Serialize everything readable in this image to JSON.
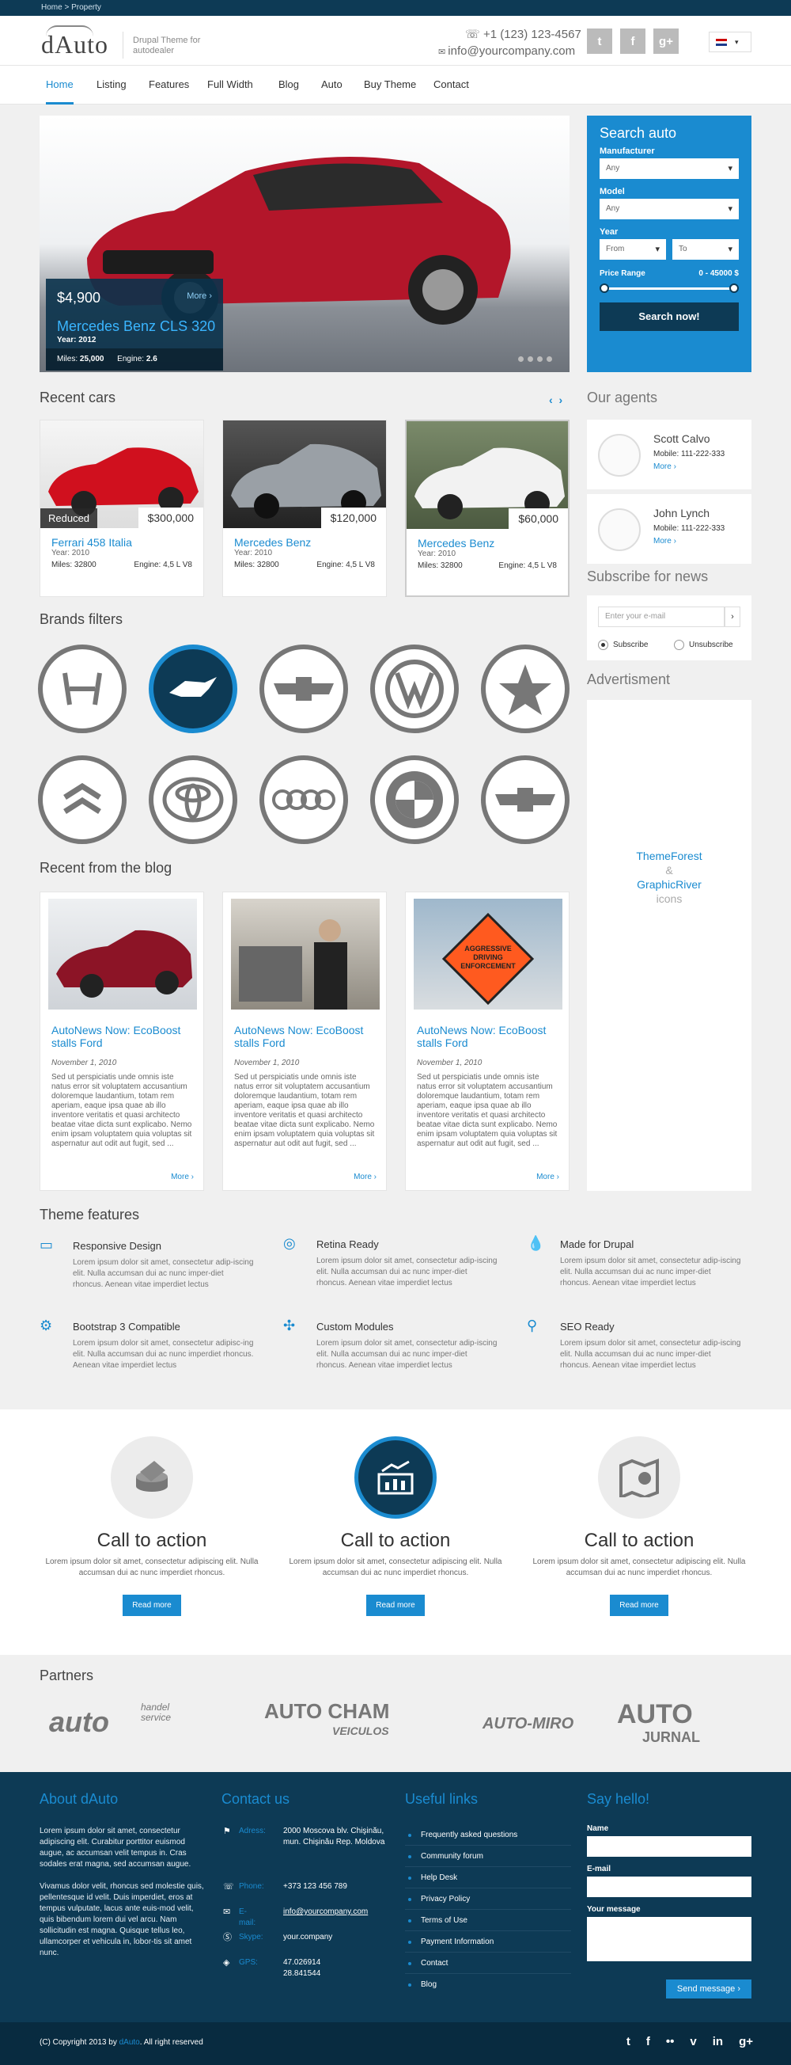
{
  "topbar": {
    "breadcrumb": "Home > Property"
  },
  "header": {
    "logo": "dAuto",
    "tagline": "Drupal Theme for autodealer",
    "phone": "+1 (123) 123-4567",
    "email": "info@yourcompany.com",
    "lang": "▾"
  },
  "nav": {
    "items": [
      "Home",
      "Listing",
      "Features",
      "Full Width",
      "Blog",
      "Auto",
      "Buy Theme",
      "Contact"
    ]
  },
  "hero": {
    "price": "$4,900",
    "more": "More",
    "title": "Mercedes Benz CLS 320",
    "year_label": "Year:",
    "year": "2012",
    "miles_label": "Miles:",
    "miles": "25,000",
    "engine_label": "Engine:",
    "engine": "2.6"
  },
  "search": {
    "title": "Search auto",
    "manufacturer_label": "Manufacturer",
    "manufacturer_value": "Any",
    "model_label": "Model",
    "model_value": "Any",
    "year_label": "Year",
    "year_from": "From",
    "year_to": "To",
    "price_label": "Price Range",
    "price_range": "0 - 45000 $",
    "button": "Search now!"
  },
  "recent": {
    "title": "Recent cars",
    "cars": [
      {
        "badge": "Reduced",
        "price": "$300,000",
        "title": "Ferrari 458 Italia",
        "year": "Year: 2010",
        "miles": "Miles: 32800",
        "engine": "Engine: 4,5 L V8"
      },
      {
        "badge": "",
        "price": "$120,000",
        "title": "Mercedes Benz",
        "year": "Year: 2010",
        "miles": "Miles: 32800",
        "engine": "Engine: 4,5 L V8"
      },
      {
        "badge": "",
        "price": "$60,000",
        "title": "Mercedes Benz",
        "year": "Year: 2010",
        "miles": "Miles: 32800",
        "engine": "Engine: 4,5 L V8"
      }
    ]
  },
  "brands": {
    "title": "Brands filters"
  },
  "agents": {
    "title": "Our agents",
    "list": [
      {
        "name": "Scott Calvo",
        "mobile": "Mobile:  111-222-333",
        "more": "More"
      },
      {
        "name": "John Lynch",
        "mobile": "Mobile:  111-222-333",
        "more": "More"
      }
    ]
  },
  "subscribe": {
    "title": "Subscribe for news",
    "placeholder": "Enter your e-mail",
    "subscribe": "Subscribe",
    "unsubscribe": "Unsubscribe"
  },
  "advert": {
    "title": "Advertisment",
    "line1": "ThemeForest",
    "line2": "&",
    "line3": "GraphicRiver",
    "line4": "icons"
  },
  "blog": {
    "title": "Recent from the blog",
    "posts": [
      {
        "title": "AutoNews Now: EcoBoost stalls Ford",
        "date": "November 1, 2010",
        "text": "Sed ut perspiciatis unde omnis iste natus error sit voluptatem accusantium doloremque laudantium, totam rem aperiam, eaque ipsa quae ab illo inventore veritatis et quasi architecto beatae vitae dicta sunt explicabo. Nemo enim ipsam voluptatem quia voluptas sit aspernatur aut odit aut fugit, sed ...",
        "more": "More"
      },
      {
        "title": "AutoNews Now: EcoBoost stalls Ford",
        "date": "November 1, 2010",
        "text": "Sed ut perspiciatis unde omnis iste natus error sit voluptatem accusantium doloremque laudantium, totam rem aperiam, eaque ipsa quae ab illo inventore veritatis et quasi architecto beatae vitae dicta sunt explicabo. Nemo enim ipsam voluptatem quia voluptas sit aspernatur aut odit aut fugit, sed ...",
        "more": "More"
      },
      {
        "title": "AutoNews Now: EcoBoost stalls Ford",
        "date": "November 1, 2010",
        "text": "Sed ut perspiciatis unde omnis iste natus error sit voluptatem accusantium doloremque laudantium, totam rem aperiam, eaque ipsa quae ab illo inventore veritatis et quasi architecto beatae vitae dicta sunt explicabo. Nemo enim ipsam voluptatem quia voluptas sit aspernatur aut odit aut fugit, sed ...",
        "more": "More"
      }
    ],
    "sign_text": "AGGRESSIVE DRIVING ENFORCEMENT"
  },
  "features": {
    "title": "Theme features",
    "items": [
      {
        "title": "Responsive Design",
        "text": "Lorem ipsum dolor sit amet, consectetur adip-iscing elit. Nulla accumsan dui ac nunc imper-diet rhoncus. Aenean vitae imperdiet lectus"
      },
      {
        "title": "Retina Ready",
        "text": "Lorem ipsum dolor sit amet, consectetur adip-iscing elit. Nulla accumsan dui ac nunc imper-diet rhoncus. Aenean vitae imperdiet lectus"
      },
      {
        "title": "Made for Drupal",
        "text": "Lorem ipsum dolor sit amet, consectetur adip-iscing elit. Nulla accumsan dui ac nunc imper-diet rhoncus. Aenean vitae imperdiet lectus"
      },
      {
        "title": "Bootstrap 3 Compatible",
        "text": "Lorem ipsum dolor sit amet, consectetur adipisc-ing elit. Nulla accumsan dui ac nunc imperdiet rhoncus. Aenean vitae imperdiet lectus"
      },
      {
        "title": "Custom Modules",
        "text": "Lorem ipsum dolor sit amet, consectetur adip-iscing elit. Nulla accumsan dui ac nunc imper-diet rhoncus. Aenean vitae imperdiet lectus"
      },
      {
        "title": "SEO Ready",
        "text": "Lorem ipsum dolor sit amet, consectetur adip-iscing elit. Nulla accumsan dui ac nunc imper-diet rhoncus. Aenean vitae imperdiet lectus"
      }
    ]
  },
  "cta": {
    "items": [
      {
        "title": "Call to action",
        "text": "Lorem ipsum dolor sit amet, consectetur adipiscing elit. Nulla accumsan dui ac nunc imperdiet rhoncus.",
        "button": "Read more"
      },
      {
        "title": "Call to action",
        "text": "Lorem ipsum dolor sit amet, consectetur adipiscing elit. Nulla accumsan dui ac nunc imperdiet rhoncus.",
        "button": "Read more"
      },
      {
        "title": "Call to action",
        "text": "Lorem ipsum dolor sit amet, consectetur adipiscing elit. Nulla accumsan dui ac nunc imperdiet rhoncus.",
        "button": "Read more"
      }
    ]
  },
  "partners": {
    "title": "Partners",
    "logos": [
      "auto",
      "handel service",
      "AUTO CHAM",
      "VEICULOS",
      "AUTO-MIRO",
      "AUTO",
      "JURNAL"
    ]
  },
  "footer": {
    "about_title": "About dAuto",
    "about_p1": "Lorem ipsum dolor sit amet, consectetur adipiscing elit. Curabitur porttitor euismod augue, ac accumsan velit tempus in. Cras sodales erat magna, sed accumsan augue.",
    "about_p2": "Vivamus dolor velit, rhoncus sed molestie quis, pellentesque id velit. Duis imperdiet, eros at tempus vulputate, lacus ante euis-mod velit, quis bibendum lorem dui vel arcu. Nam sollicitudin est magna. Quisque tellus leo, ullamcorper et vehicula in, lobor-tis sit amet nunc.",
    "contact_title": "Contact us",
    "address_label": "Adress:",
    "address": "2000 Moscova blv. Chişinău, mun. Chişinău Rep. Moldova",
    "phone_label": "Phone:",
    "phone": "+373 123 456 789",
    "email_label": "E-mail:",
    "email": "info@yourcompany.com",
    "skype_label": "Skype:",
    "skype": "your.company",
    "gps_label": "GPS:",
    "gps1": "47.026914",
    "gps2": "28.841544",
    "links_title": "Useful links",
    "links": [
      "Frequently asked questions",
      "Community forum",
      "Help Desk",
      "Privacy Policy",
      "Terms of Use",
      "Payment Information",
      "Contact",
      "Blog"
    ],
    "hello_title": "Say hello!",
    "name_label": "Name",
    "email_field_label": "E-mail",
    "message_label": "Your message",
    "send": "Send message"
  },
  "bottom": {
    "copy_pre": "(C) Copyright 2013 by ",
    "copy_brand": "dAuto",
    "copy_post": ". All right reserved"
  },
  "colors": {
    "accent": "#1a8bd0",
    "dark": "#0d3a55"
  }
}
